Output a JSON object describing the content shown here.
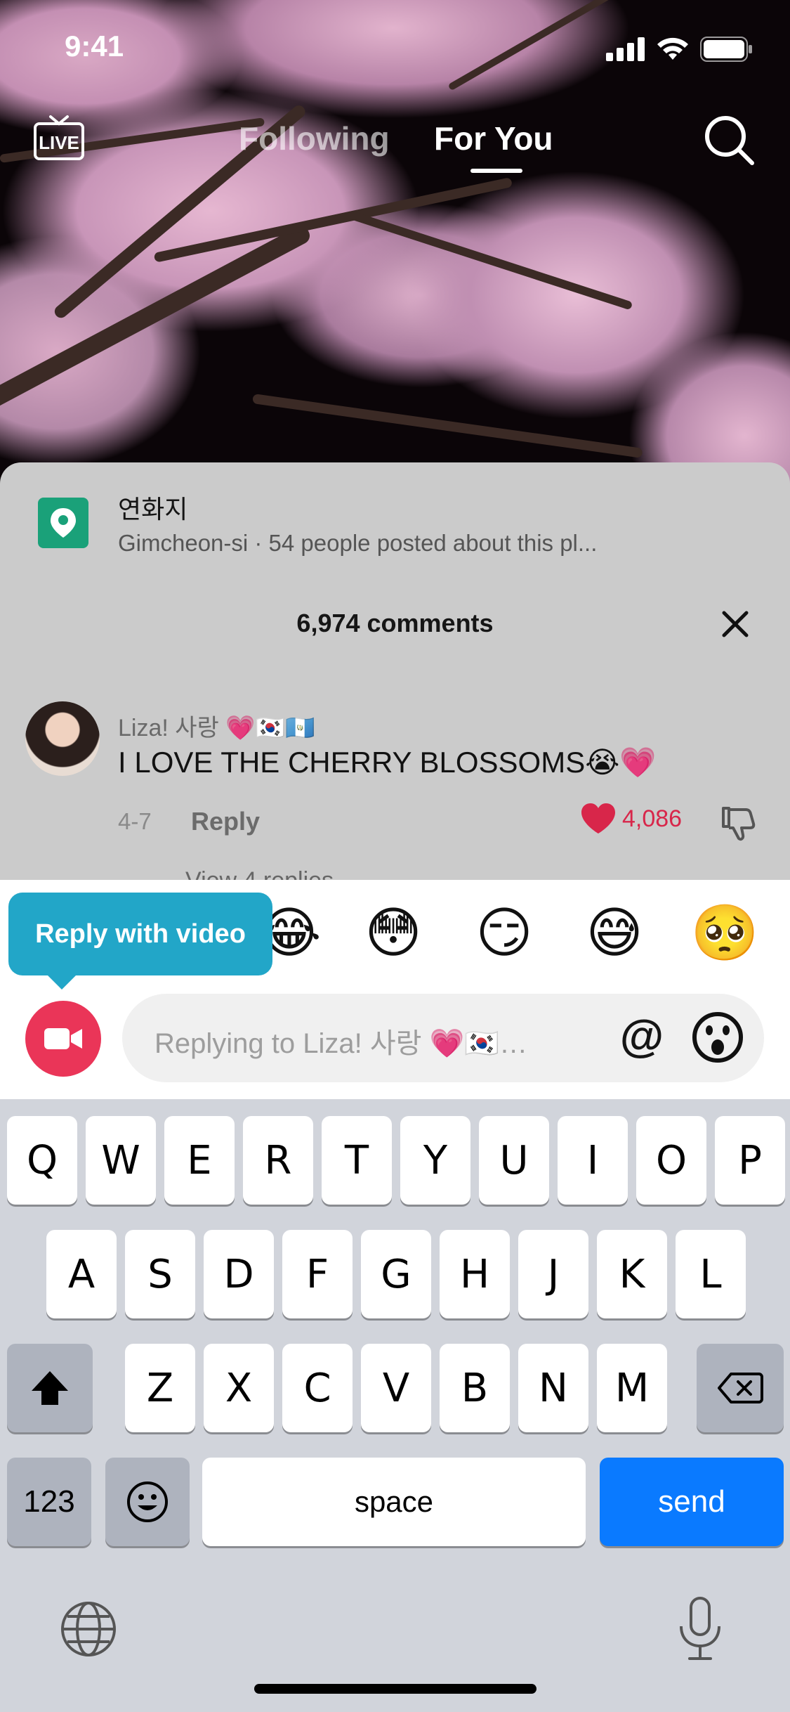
{
  "status_bar": {
    "time": "9:41"
  },
  "top_nav": {
    "live_label": "LIVE",
    "tabs": [
      {
        "label": "Following",
        "active": false
      },
      {
        "label": "For You",
        "active": true
      }
    ],
    "search_icon": "search-icon"
  },
  "location": {
    "name": "연화지",
    "subtitle": "Gimcheon-si · 54 people posted about this pl...",
    "icon": "location-pin-icon",
    "color": "#1aa179"
  },
  "comments": {
    "count_label": "6,974 comments",
    "items": [
      {
        "username": "Liza! 사랑 💗🇰🇷🇬🇹",
        "text": "I LOVE THE CHERRY BLOSSOMS😭💗",
        "date": "4-7",
        "reply_label": "Reply",
        "likes": "4,086",
        "liked": true
      }
    ],
    "view_replies_partial": "View 4 replies"
  },
  "reply_panel": {
    "quick_emojis": [
      "😂",
      "😳",
      "😏",
      "😅",
      "🥺"
    ],
    "video_tooltip": "Reply with video",
    "placeholder": "Replying to Liza! 사랑 💗🇰🇷…",
    "at_symbol": "@"
  },
  "keyboard": {
    "row1": [
      "Q",
      "W",
      "E",
      "R",
      "T",
      "Y",
      "U",
      "I",
      "O",
      "P"
    ],
    "row2": [
      "A",
      "S",
      "D",
      "F",
      "G",
      "H",
      "J",
      "K",
      "L"
    ],
    "row3": [
      "Z",
      "X",
      "C",
      "V",
      "B",
      "N",
      "M"
    ],
    "numbers_label": "123",
    "space_label": "space",
    "send_label": "send",
    "emoji_key": "😃"
  },
  "colors": {
    "accent_red": "#ea3558",
    "like_red": "#d8264a",
    "send_blue": "#0a7aff",
    "tooltip_teal": "#22a6c8"
  }
}
